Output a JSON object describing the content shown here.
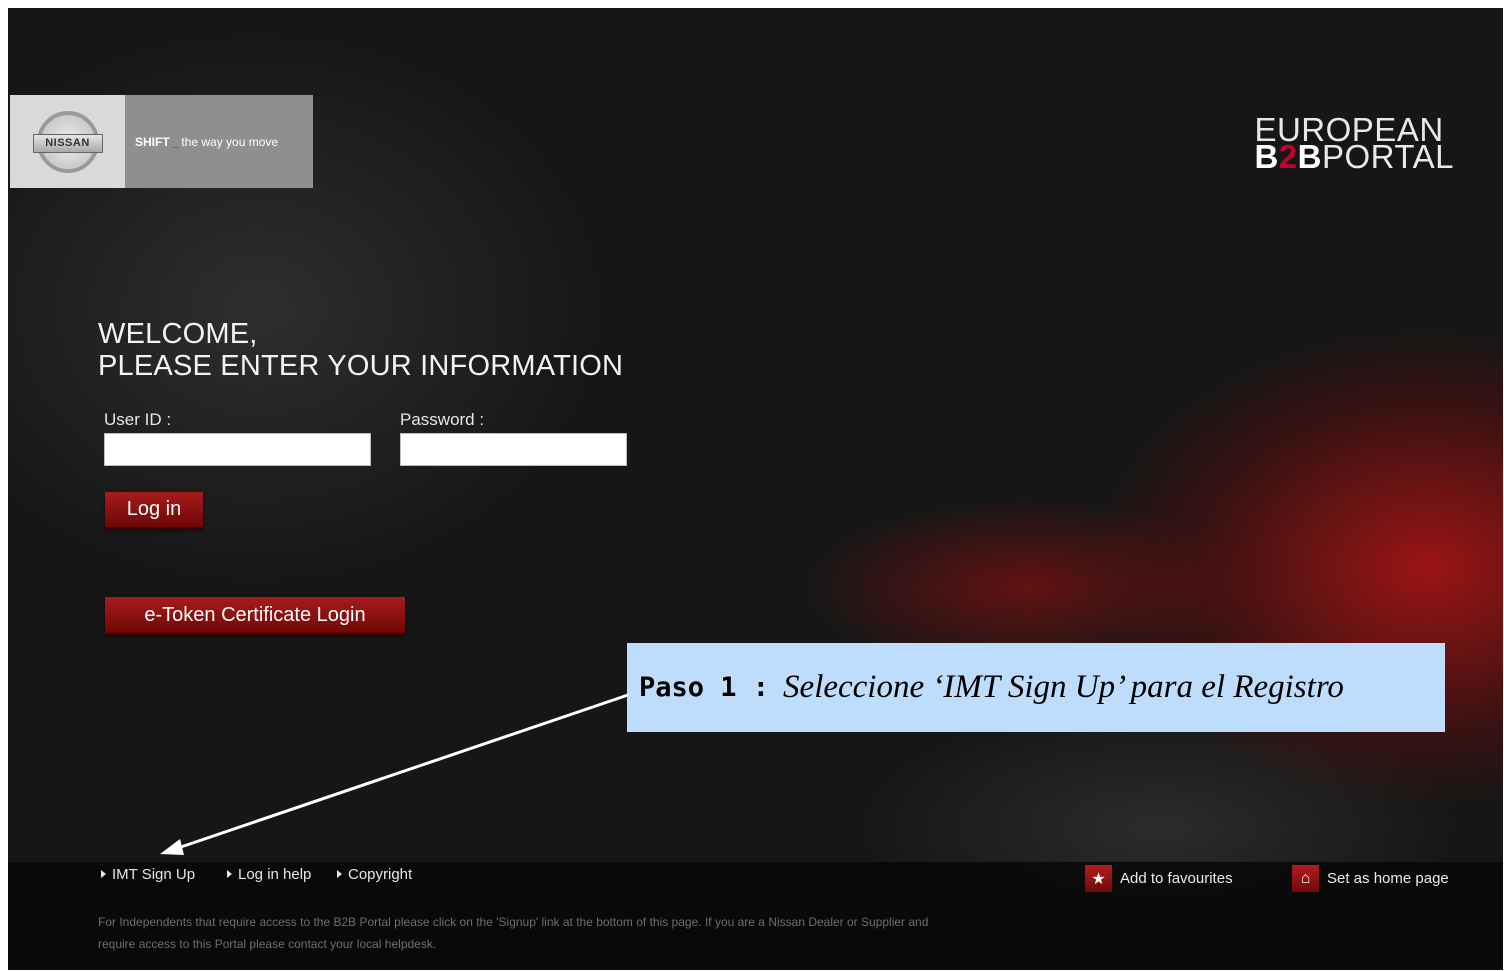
{
  "header": {
    "brand_badge": "NISSAN",
    "tagline_bold": "SHIFT",
    "tagline_underscore": "_",
    "tagline_rest": "the way you move",
    "portal_line1": "EUROPEAN",
    "portal_b1": "B",
    "portal_2": "2",
    "portal_b2": "B",
    "portal_rest": "PORTAL"
  },
  "login": {
    "welcome_line1": "WELCOME,",
    "welcome_line2": "PLEASE ENTER YOUR INFORMATION",
    "user_id_label": "User ID :",
    "user_id_value": "",
    "password_label": "Password :",
    "password_value": "",
    "login_button": "Log in",
    "etoken_button": "e-Token Certificate Login"
  },
  "callout": {
    "step": "Paso 1 :",
    "text": "Seleccione ‘IMT Sign Up’ para el Registro"
  },
  "footer": {
    "links": [
      "IMT Sign Up",
      "Log in help",
      "Copyright"
    ],
    "add_favourites": "Add to favourites",
    "set_home": "Set as home page",
    "note": "For Independents that require access to the B2B Portal please click on the 'Signup' link at the bottom of this page. If you are a Nissan Dealer or Supplier and require access to this Portal please contact your local helpdesk."
  },
  "colors": {
    "brand_red": "#c3002f",
    "button_red": "#8f1212",
    "callout_bg": "#bedcfb"
  },
  "icons": {
    "favourites": "star-icon",
    "home": "home-icon",
    "link_marker": "triangle-right-icon"
  }
}
